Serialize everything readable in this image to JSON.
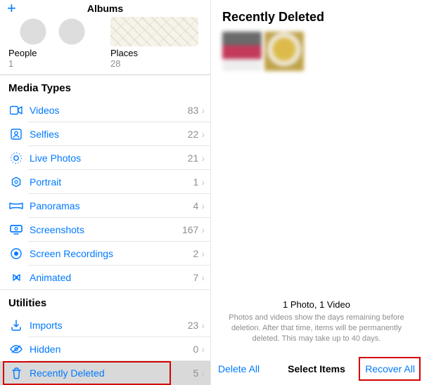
{
  "left": {
    "nav": {
      "title": "Albums"
    },
    "albums": {
      "people": {
        "label": "People",
        "count": "1"
      },
      "places": {
        "label": "Places",
        "count": "28"
      }
    },
    "sections": {
      "media_types": {
        "header": "Media Types",
        "rows": [
          {
            "icon": "video-icon",
            "label": "Videos",
            "count": "83"
          },
          {
            "icon": "selfies-icon",
            "label": "Selfies",
            "count": "22"
          },
          {
            "icon": "livephotos-icon",
            "label": "Live Photos",
            "count": "21"
          },
          {
            "icon": "portrait-icon",
            "label": "Portrait",
            "count": "1"
          },
          {
            "icon": "panorama-icon",
            "label": "Panoramas",
            "count": "4"
          },
          {
            "icon": "screenshots-icon",
            "label": "Screenshots",
            "count": "167"
          },
          {
            "icon": "screenrec-icon",
            "label": "Screen Recordings",
            "count": "2"
          },
          {
            "icon": "animated-icon",
            "label": "Animated",
            "count": "7"
          }
        ]
      },
      "utilities": {
        "header": "Utilities",
        "rows": [
          {
            "icon": "imports-icon",
            "label": "Imports",
            "count": "23"
          },
          {
            "icon": "hidden-icon",
            "label": "Hidden",
            "count": "0"
          },
          {
            "icon": "trash-icon",
            "label": "Recently Deleted",
            "count": "5"
          }
        ]
      }
    }
  },
  "right": {
    "title": "Recently Deleted",
    "info_line1": "1 Photo, 1 Video",
    "info_line2": "Photos and videos show the days remaining before deletion. After that time, items will be permanently deleted. This may take up to 40 days.",
    "toolbar": {
      "delete": "Delete All",
      "select": "Select Items",
      "recover": "Recover All"
    }
  }
}
